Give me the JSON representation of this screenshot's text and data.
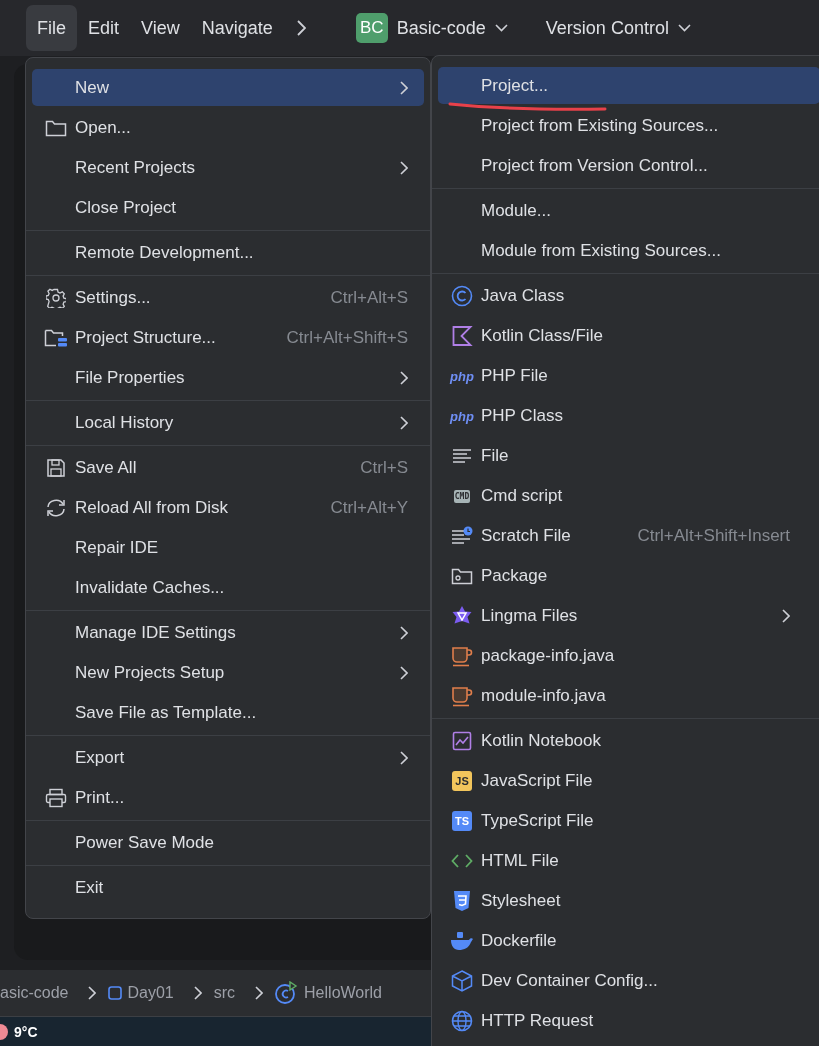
{
  "menubar": {
    "items": [
      {
        "label": "File",
        "selected": true
      },
      {
        "label": "Edit",
        "selected": false
      },
      {
        "label": "View",
        "selected": false
      },
      {
        "label": "Navigate",
        "selected": false
      }
    ],
    "project": {
      "badge": "BC",
      "name": "Basic-code"
    },
    "vcs": {
      "label": "Version Control"
    }
  },
  "file_menu": {
    "items": [
      {
        "kind": "item",
        "label": "New",
        "submenu": true,
        "selected": true
      },
      {
        "kind": "item",
        "label": "Open...",
        "submenu": false,
        "selected": false
      },
      {
        "kind": "item",
        "label": "Recent Projects",
        "submenu": true,
        "selected": false
      },
      {
        "kind": "item",
        "label": "Close Project",
        "submenu": false,
        "selected": false
      },
      {
        "kind": "separator"
      },
      {
        "kind": "item",
        "label": "Remote Development...",
        "submenu": false,
        "selected": false
      },
      {
        "kind": "separator"
      },
      {
        "kind": "item",
        "label": "Settings...",
        "shortcut": "Ctrl+Alt+S",
        "submenu": false,
        "selected": false
      },
      {
        "kind": "item",
        "label": "Project Structure...",
        "shortcut": "Ctrl+Alt+Shift+S",
        "submenu": false,
        "selected": false
      },
      {
        "kind": "item",
        "label": "File Properties",
        "submenu": true,
        "selected": false
      },
      {
        "kind": "separator"
      },
      {
        "kind": "item",
        "label": "Local History",
        "submenu": true,
        "selected": false
      },
      {
        "kind": "separator"
      },
      {
        "kind": "item",
        "label": "Save All",
        "shortcut": "Ctrl+S",
        "submenu": false,
        "selected": false
      },
      {
        "kind": "item",
        "label": "Reload All from Disk",
        "shortcut": "Ctrl+Alt+Y",
        "submenu": false,
        "selected": false
      },
      {
        "kind": "item",
        "label": "Repair IDE",
        "submenu": false,
        "selected": false
      },
      {
        "kind": "item",
        "label": "Invalidate Caches...",
        "submenu": false,
        "selected": false
      },
      {
        "kind": "separator"
      },
      {
        "kind": "item",
        "label": "Manage IDE Settings",
        "submenu": true,
        "selected": false
      },
      {
        "kind": "item",
        "label": "New Projects Setup",
        "submenu": true,
        "selected": false
      },
      {
        "kind": "item",
        "label": "Save File as Template...",
        "submenu": false,
        "selected": false
      },
      {
        "kind": "separator"
      },
      {
        "kind": "item",
        "label": "Export",
        "submenu": true,
        "selected": false
      },
      {
        "kind": "item",
        "label": "Print...",
        "submenu": false,
        "selected": false
      },
      {
        "kind": "separator"
      },
      {
        "kind": "item",
        "label": "Power Save Mode",
        "submenu": false,
        "selected": false
      },
      {
        "kind": "separator"
      },
      {
        "kind": "item",
        "label": "Exit",
        "submenu": false,
        "selected": false
      }
    ]
  },
  "new_menu": {
    "items": [
      {
        "kind": "item",
        "label": "Project...",
        "submenu": false,
        "selected": true
      },
      {
        "kind": "item",
        "label": "Project from Existing Sources...",
        "submenu": false,
        "selected": false
      },
      {
        "kind": "item",
        "label": "Project from Version Control...",
        "submenu": false,
        "selected": false
      },
      {
        "kind": "separator"
      },
      {
        "kind": "item",
        "label": "Module...",
        "submenu": false,
        "selected": false
      },
      {
        "kind": "item",
        "label": "Module from Existing Sources...",
        "submenu": false,
        "selected": false
      },
      {
        "kind": "separator"
      },
      {
        "kind": "item",
        "label": "Java Class",
        "submenu": false,
        "selected": false
      },
      {
        "kind": "item",
        "label": "Kotlin Class/File",
        "submenu": false,
        "selected": false
      },
      {
        "kind": "item",
        "label": "PHP File",
        "badge": "php",
        "submenu": false,
        "selected": false
      },
      {
        "kind": "item",
        "label": "PHP Class",
        "badge": "php",
        "submenu": false,
        "selected": false
      },
      {
        "kind": "item",
        "label": "File",
        "submenu": false,
        "selected": false
      },
      {
        "kind": "item",
        "label": "Cmd script",
        "badge": "CMD",
        "submenu": false,
        "selected": false
      },
      {
        "kind": "item",
        "label": "Scratch File",
        "shortcut": "Ctrl+Alt+Shift+Insert",
        "submenu": false,
        "selected": false
      },
      {
        "kind": "item",
        "label": "Package",
        "submenu": false,
        "selected": false
      },
      {
        "kind": "item",
        "label": "Lingma Files",
        "submenu": true,
        "selected": false
      },
      {
        "kind": "item",
        "label": "package-info.java",
        "submenu": false,
        "selected": false
      },
      {
        "kind": "item",
        "label": "module-info.java",
        "submenu": false,
        "selected": false
      },
      {
        "kind": "separator"
      },
      {
        "kind": "item",
        "label": "Kotlin Notebook",
        "submenu": false,
        "selected": false
      },
      {
        "kind": "item",
        "label": "JavaScript File",
        "badge": "JS",
        "submenu": false,
        "selected": false
      },
      {
        "kind": "item",
        "label": "TypeScript File",
        "badge": "TS",
        "submenu": false,
        "selected": false
      },
      {
        "kind": "item",
        "label": "HTML File",
        "submenu": false,
        "selected": false
      },
      {
        "kind": "item",
        "label": "Stylesheet",
        "submenu": false,
        "selected": false
      },
      {
        "kind": "item",
        "label": "Dockerfile",
        "submenu": false,
        "selected": false
      },
      {
        "kind": "item",
        "label": "Dev Container Config...",
        "submenu": false,
        "selected": false
      },
      {
        "kind": "item",
        "label": "HTTP Request",
        "submenu": false,
        "selected": false
      }
    ]
  },
  "breadcrumbs": [
    "asic-code",
    "Day01",
    "src",
    "HelloWorld"
  ],
  "taskbar": {
    "weather": "9°C"
  }
}
